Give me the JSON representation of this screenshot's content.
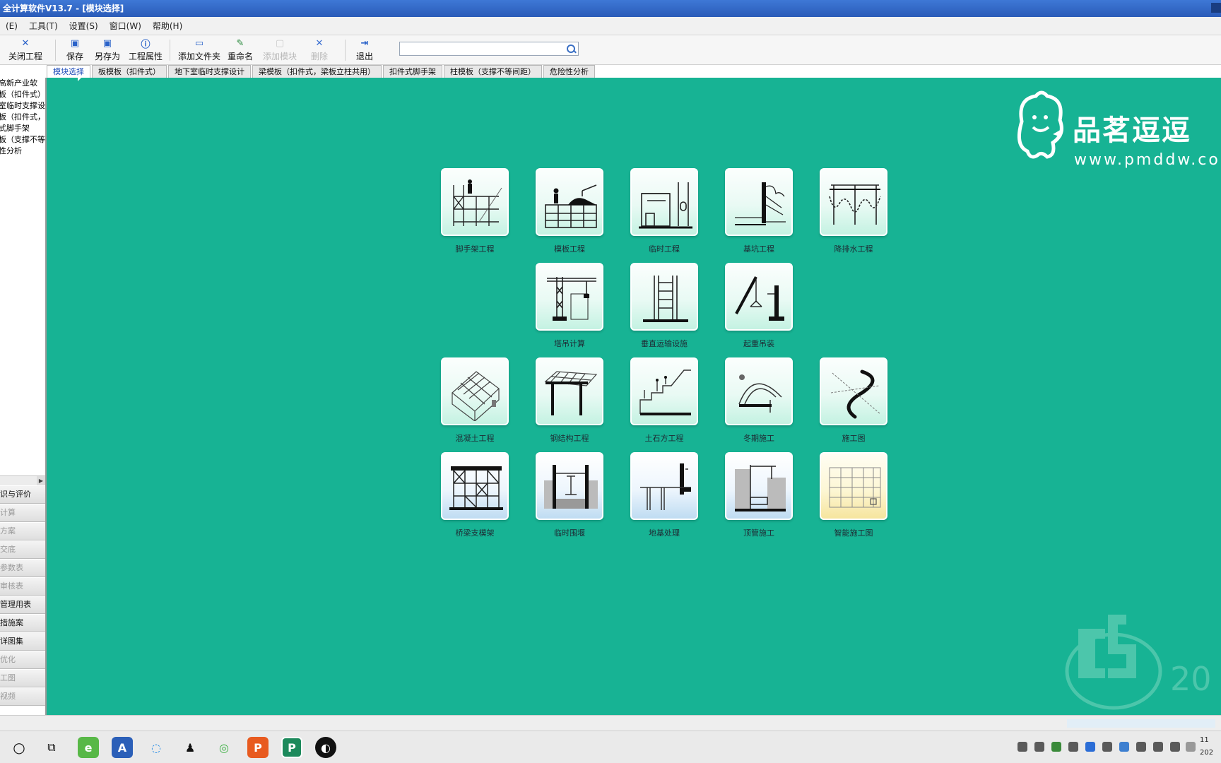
{
  "window": {
    "title": "全计算软件V13.7 - [模块选择]"
  },
  "menu": [
    {
      "label": "(E)"
    },
    {
      "label": "工具(T)"
    },
    {
      "label": "设置(S)"
    },
    {
      "label": "窗口(W)"
    },
    {
      "label": "帮助(H)"
    }
  ],
  "toolbar": {
    "close_project": "关闭工程",
    "save": "保存",
    "save_as": "另存为",
    "project_props": "工程属性",
    "add_folder": "添加文件夹",
    "rename": "重命名",
    "add_template": "添加模块",
    "delete": "删除",
    "exit": "退出",
    "search_value": ""
  },
  "tabs": [
    {
      "label": "模块选择",
      "active": true
    },
    {
      "label": "板模板（扣件式）"
    },
    {
      "label": "地下室临时支撑设计"
    },
    {
      "label": "梁模板（扣件式，梁板立柱共用）"
    },
    {
      "label": "扣件式脚手架"
    },
    {
      "label": "柱模板（支撑不等间距）"
    },
    {
      "label": "危险性分析"
    }
  ],
  "tree": [
    {
      "label": "高新产业软"
    },
    {
      "label": "板（扣件式）"
    },
    {
      "label": "室临时支撑设"
    },
    {
      "label": "板（扣件式，"
    },
    {
      "label": "式脚手架"
    },
    {
      "label": "板（支撑不等"
    },
    {
      "label": "性分析"
    }
  ],
  "nav": [
    {
      "label": "识与评价",
      "dark": true
    },
    {
      "label": "计算"
    },
    {
      "label": "方案"
    },
    {
      "label": "交底"
    },
    {
      "label": "参数表"
    },
    {
      "label": "审核表"
    },
    {
      "label": "管理用表",
      "dark": true
    },
    {
      "label": "措施案",
      "dark": true
    },
    {
      "label": "详图集",
      "dark": true
    },
    {
      "label": "优化"
    },
    {
      "label": "工图"
    },
    {
      "label": "视频"
    }
  ],
  "modules": [
    {
      "label": "脚手架工程",
      "icon": "scaffold-icon"
    },
    {
      "label": "模板工程",
      "icon": "formwork-icon"
    },
    {
      "label": "临时工程",
      "icon": "temporary-works-icon"
    },
    {
      "label": "基坑工程",
      "icon": "foundation-pit-icon"
    },
    {
      "label": "降排水工程",
      "icon": "dewatering-icon"
    },
    {
      "label": "塔吊计算",
      "icon": "tower-crane-icon"
    },
    {
      "label": "垂直运输设施",
      "icon": "hoist-icon"
    },
    {
      "label": "起重吊装",
      "icon": "lifting-icon"
    },
    {
      "label": "混凝土工程",
      "icon": "concrete-icon"
    },
    {
      "label": "钢结构工程",
      "icon": "steel-structure-icon"
    },
    {
      "label": "土石方工程",
      "icon": "earthwork-icon"
    },
    {
      "label": "冬期施工",
      "icon": "winter-construction-icon"
    },
    {
      "label": "施工图",
      "icon": "construction-drawing-icon"
    },
    {
      "label": "桥梁支模架",
      "icon": "bridge-formwork-icon"
    },
    {
      "label": "临时围堰",
      "icon": "cofferdam-icon"
    },
    {
      "label": "地基处理",
      "icon": "ground-treatment-icon"
    },
    {
      "label": "顶管施工",
      "icon": "pipe-jacking-icon"
    },
    {
      "label": "智能施工图",
      "icon": "smart-drawing-icon"
    }
  ],
  "logo": {
    "title": "品茗逗逗",
    "url": "www.pmddw.co"
  },
  "watermark": {
    "year": "20"
  },
  "taskbar": {
    "time": "11",
    "date": "202"
  }
}
